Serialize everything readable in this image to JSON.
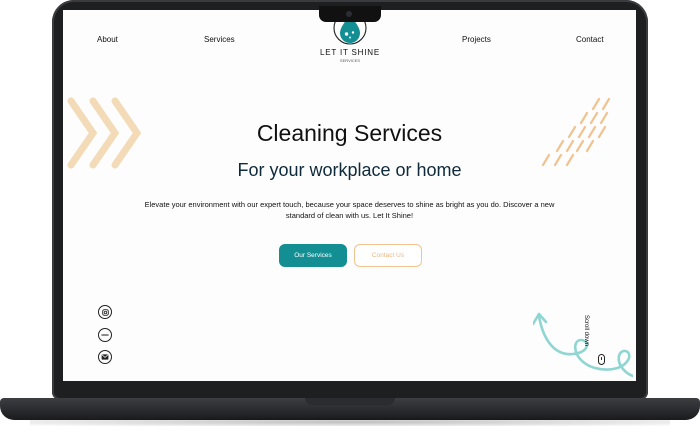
{
  "nav": {
    "about": "About",
    "services": "Services",
    "projects": "Projects",
    "contact": "Contact"
  },
  "logo": {
    "title": "LET IT SHINE",
    "subtitle": "SERVICES"
  },
  "hero": {
    "title": "Cleaning Services",
    "subtitle": "For your workplace or home",
    "description": "Elevate your environment with our expert touch, because your space deserves to shine as bright as you do. Discover a new standard of clean with us. Let It Shine!",
    "primary_button": "Our Services",
    "secondary_button": "Contact Us"
  },
  "social": {
    "icons": [
      "instagram-icon",
      "linkedin-icon",
      "email-icon"
    ]
  },
  "scroll": {
    "label": "Scroll down"
  },
  "colors": {
    "accent": "#138f94",
    "secondary": "#f1c391",
    "decor": "#f3dbb8",
    "swirl": "#8fd6d3"
  }
}
